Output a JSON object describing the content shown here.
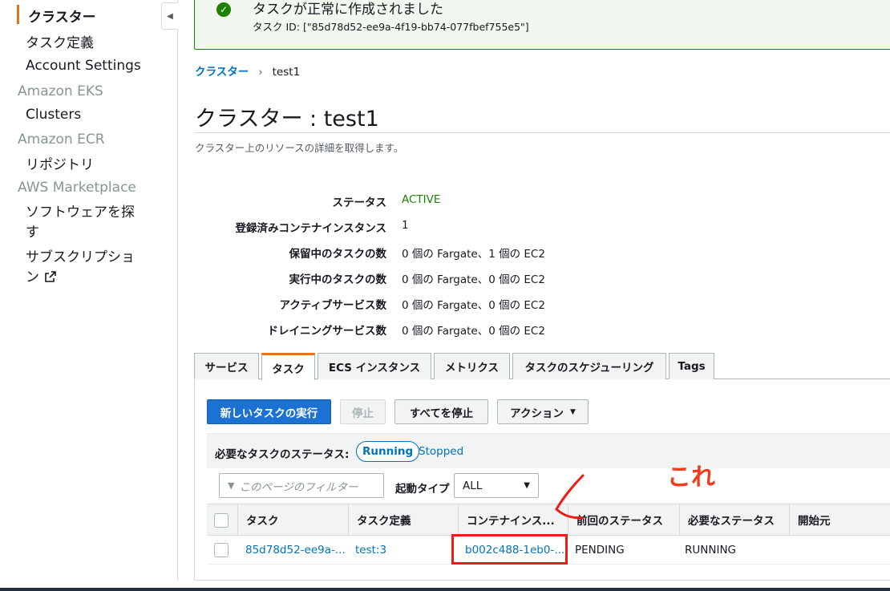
{
  "sidebar": {
    "items": [
      {
        "label": "クラスター",
        "active": true
      },
      {
        "label": "タスク定義"
      },
      {
        "label": "Account Settings"
      }
    ],
    "eks": {
      "section": "Amazon EKS",
      "items": [
        {
          "label": "Clusters"
        }
      ]
    },
    "ecr": {
      "section": "Amazon ECR",
      "items": [
        {
          "label": "リポジトリ"
        }
      ]
    },
    "marketplace": {
      "section": "AWS Marketplace",
      "items": [
        {
          "label_line1": "ソフトウェアを探",
          "label_line2": "す"
        },
        {
          "label_line1": "サブスクリプショ",
          "label_line2": "ン"
        }
      ]
    },
    "collapse_icon": "chevron-left-icon"
  },
  "flash": {
    "title": "タスクが正常に作成されました",
    "subtitle": "タスク ID: [\"85d78d52-ee9a-4f19-bb74-077fbef755e5\"]",
    "icon": "check-circle-icon",
    "color": "#1d8102"
  },
  "breadcrumb": {
    "root": "クラスター",
    "current": "test1"
  },
  "page": {
    "title": "クラスター : test1",
    "description": "クラスター上のリソースの詳細を取得します。"
  },
  "details": [
    {
      "label": "ステータス",
      "value": "ACTIVE"
    },
    {
      "label": "登録済みコンテナインスタンス",
      "value": "1"
    },
    {
      "label": "保留中のタスクの数",
      "value": "0 個の Fargate、1 個の EC2"
    },
    {
      "label": "実行中のタスクの数",
      "value": "0 個の Fargate、0 個の EC2"
    },
    {
      "label": "アクティブサービス数",
      "value": "0 個の Fargate、0 個の EC2"
    },
    {
      "label": "ドレイニングサービス数",
      "value": "0 個の Fargate、0 個の EC2"
    }
  ],
  "tabs": [
    {
      "label": "サービス"
    },
    {
      "label": "タスク",
      "selected": true
    },
    {
      "label": "ECS インスタンス"
    },
    {
      "label": "メトリクス"
    },
    {
      "label": "タスクのスケジューリング"
    },
    {
      "label": "Tags"
    }
  ],
  "toolbar": {
    "run_new_task": "新しいタスクの実行",
    "stop": "停止",
    "stop_all": "すべてを停止",
    "actions": "アクション"
  },
  "status_filter": {
    "label": "必要なタスクのステータス:",
    "running": "Running",
    "stopped": "Stopped"
  },
  "filter": {
    "placeholder": "このページのフィルター",
    "launch_type_label": "起動タイプ",
    "launch_type_value": "ALL"
  },
  "table": {
    "columns": [
      "タスク",
      "タスク定義",
      "コンテナインス...",
      "前回のステータス",
      "必要なステータス",
      "開始元"
    ],
    "rows": [
      {
        "task": "85d78d52-ee9a-...",
        "task_definition": "test:3",
        "container_instance": "b002c488-1eb0-...",
        "last_status": "PENDING",
        "desired_status": "RUNNING",
        "started_by": ""
      }
    ]
  },
  "annotation": {
    "text": "これ",
    "color": "#ee3c1c"
  },
  "colors": {
    "accent": "#ec7211",
    "link": "#0073bb",
    "primary_button": "#1b72d2",
    "success": "#1d8102",
    "annotation": "#ee1c14"
  }
}
